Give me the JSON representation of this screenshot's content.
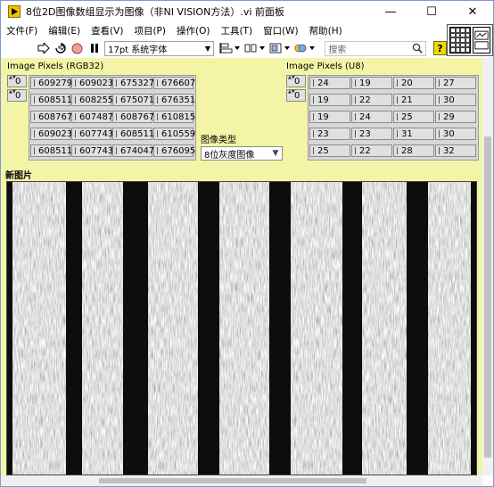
{
  "window": {
    "title": "8位2D图像数组显示为图像（非NI VISION方法）.vi 前面板",
    "minimize_glyph": "—",
    "maximize_glyph": "☐",
    "close_glyph": "✕"
  },
  "menu": [
    "文件(F)",
    "编辑(E)",
    "查看(V)",
    "项目(P)",
    "操作(O)",
    "工具(T)",
    "窗口(W)",
    "帮助(H)"
  ],
  "toolbar": {
    "run_icon": "arrow-right-icon",
    "continuous_icon": "run-continuously-icon",
    "abort_icon": "stop-icon",
    "pause_icon": "pause-icon",
    "font_value": "17pt 系统字体",
    "align_icon": "align-objects-icon",
    "distribute_icon": "distribute-objects-icon",
    "resize_icon": "resize-objects-icon",
    "reorder_icon": "reorder-icon",
    "search_placeholder": "搜索",
    "help_label": "?"
  },
  "rgb_array": {
    "label": "Image Pixels (RGB32)",
    "index_row": "0",
    "index_col": "0",
    "rows": [
      [
        "609279",
        "609023",
        "675327",
        "676607"
      ],
      [
        "608511",
        "608255",
        "675071",
        "676351"
      ],
      [
        "608767",
        "607487",
        "608767",
        "610815"
      ],
      [
        "609023",
        "607743",
        "608511",
        "610559"
      ],
      [
        "608511",
        "607743",
        "674047",
        "676095"
      ]
    ]
  },
  "u8_array": {
    "label": "Image Pixels (U8)",
    "index_row": "0",
    "index_col": "0",
    "rows": [
      [
        "24",
        "19",
        "20",
        "27"
      ],
      [
        "19",
        "22",
        "21",
        "30"
      ],
      [
        "19",
        "24",
        "25",
        "29"
      ],
      [
        "23",
        "23",
        "31",
        "30"
      ],
      [
        "25",
        "22",
        "28",
        "32"
      ]
    ]
  },
  "image_type": {
    "label": "图像类型",
    "value": "8位灰度图像"
  },
  "image_display": {
    "label": "新图片"
  }
}
